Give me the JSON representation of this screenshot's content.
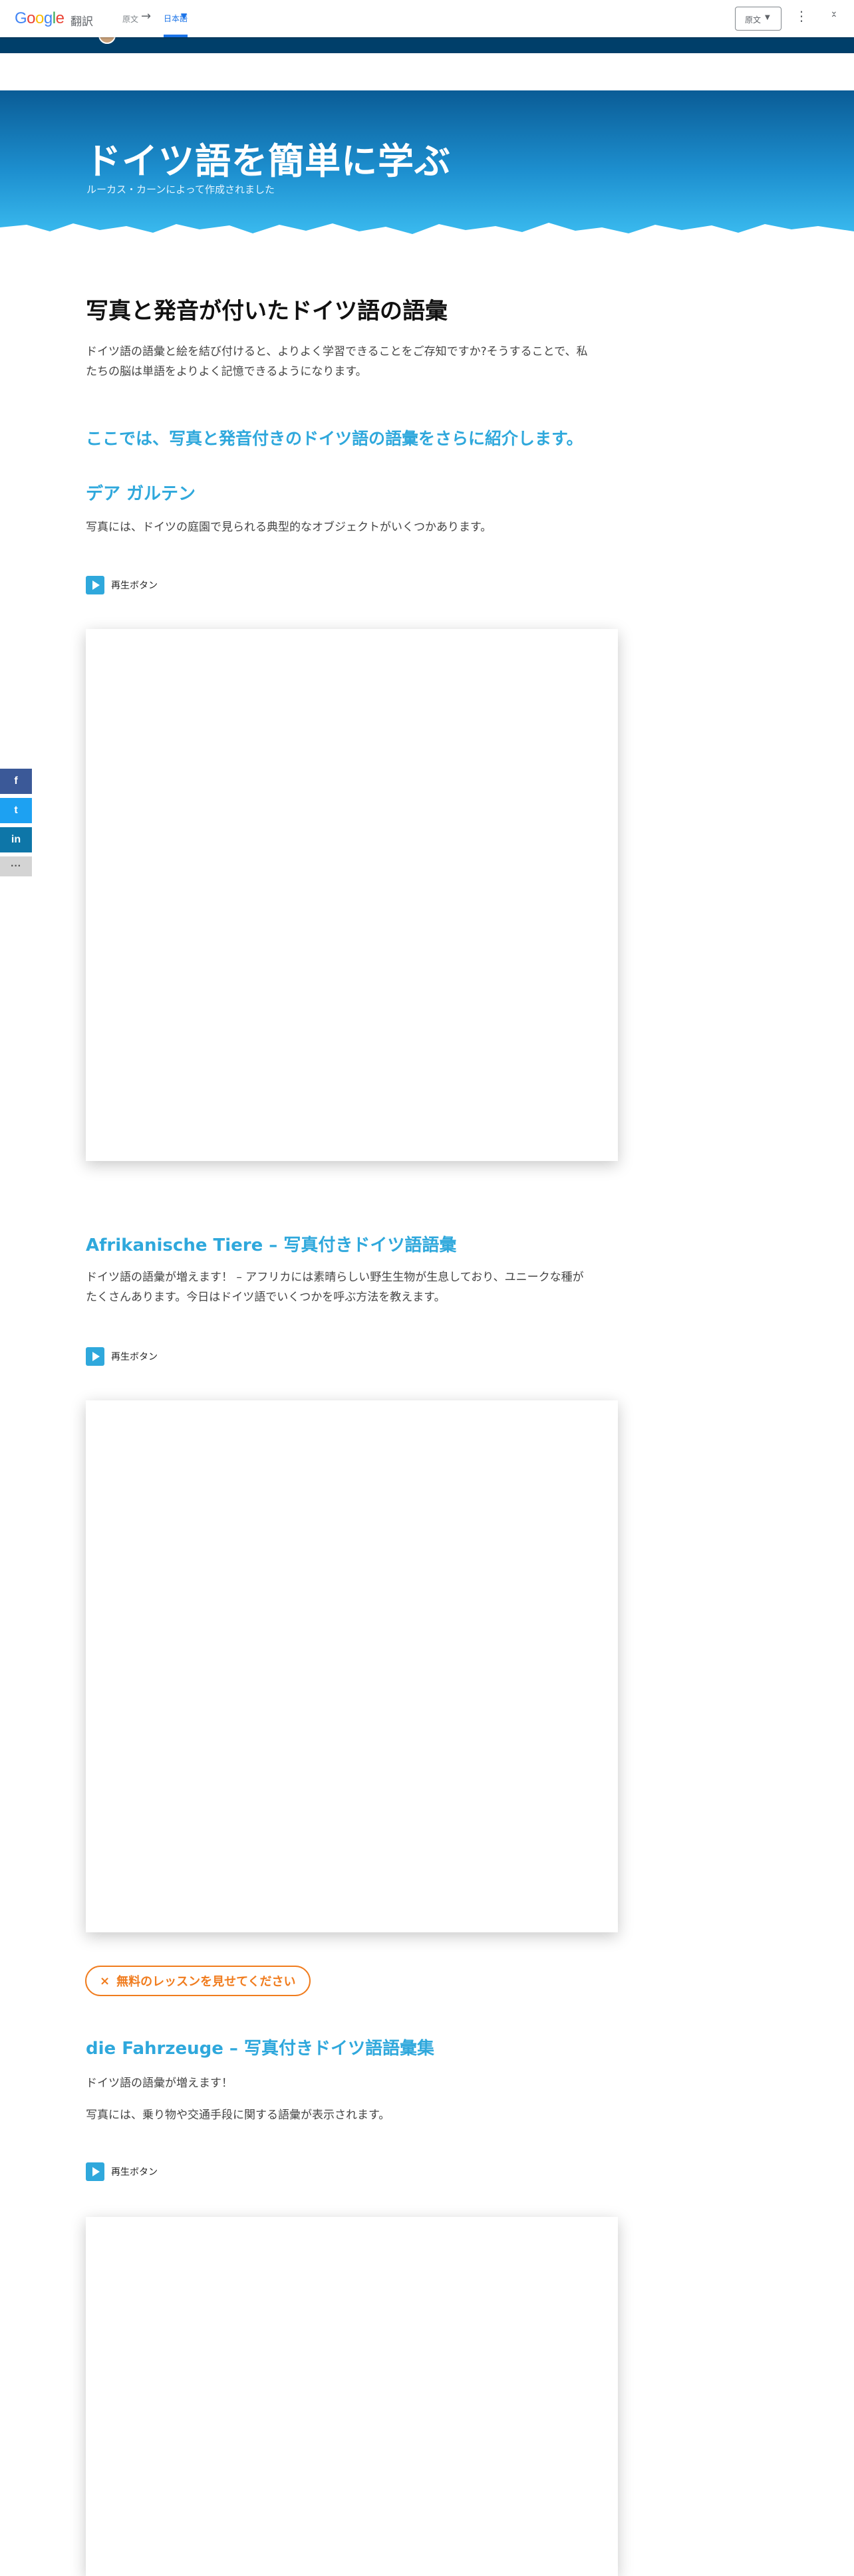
{
  "translate_bar": {
    "logo_letters": [
      "G",
      "o",
      "o",
      "g",
      "l",
      "e"
    ],
    "product": "翻訳",
    "source_lang": "原文",
    "arrow": "→",
    "target_lang": "日本語",
    "original_button": "原文",
    "more_icon": "kebab-menu-icon",
    "collapse_icon": "collapse-icon"
  },
  "hero": {
    "title": "ドイツ語を簡単に学ぶ",
    "subtitle": "ルーカス・カーンによって作成されました"
  },
  "article": {
    "heading": "写真と発音が付いたドイツ語の語彙",
    "intro_line1": "ドイツ語の語彙と絵を結び付けると、よりよく学習できることをご存知ですか?そうすることで、私",
    "intro_line2": "たちの脳は単語をよりよく記憶できるようになります。",
    "section_heading": "ここでは、写真と発音付きのドイツ語の語彙をさらに紹介します。",
    "s1_title": "デア ガルテン",
    "s1_text": "写真には、ドイツの庭園で見られる典型的なオブジェクトがいくつかあります。",
    "play_label": "再生ボタン",
    "s2_title": "Afrikanische Tiere – 写真付きドイツ語語彙",
    "s2_text_line1": "ドイツ語の語彙が増えます！ – アフリカには素晴らしい野生生物が生息しており、ユニークな種が",
    "s2_text_line2": "たくさんあります。今日はドイツ語でいくつかを呼ぶ方法を教えます。",
    "lesson_button": "無料のレッスンを見せてください",
    "lesson_icon": "×",
    "s3_title": "die Fahrzeuge – 写真付きドイツ語語彙集",
    "s3_text1": "ドイツ語の語彙が増えます！",
    "s3_text2": "写真には、乗り物や交通手段に関する語彙が表示されます。"
  },
  "share": {
    "facebook": "f",
    "twitter": "t",
    "linkedin": "in",
    "more": "···",
    "colors": {
      "facebook": "#3b5998",
      "twitter": "#1da1f2",
      "linkedin": "#0e76a8",
      "more": "#d4d4d4"
    }
  },
  "colors": {
    "accent": "#2fa8dc",
    "lesson_orange": "#f07c1e",
    "header_navy": "#003f6a"
  }
}
